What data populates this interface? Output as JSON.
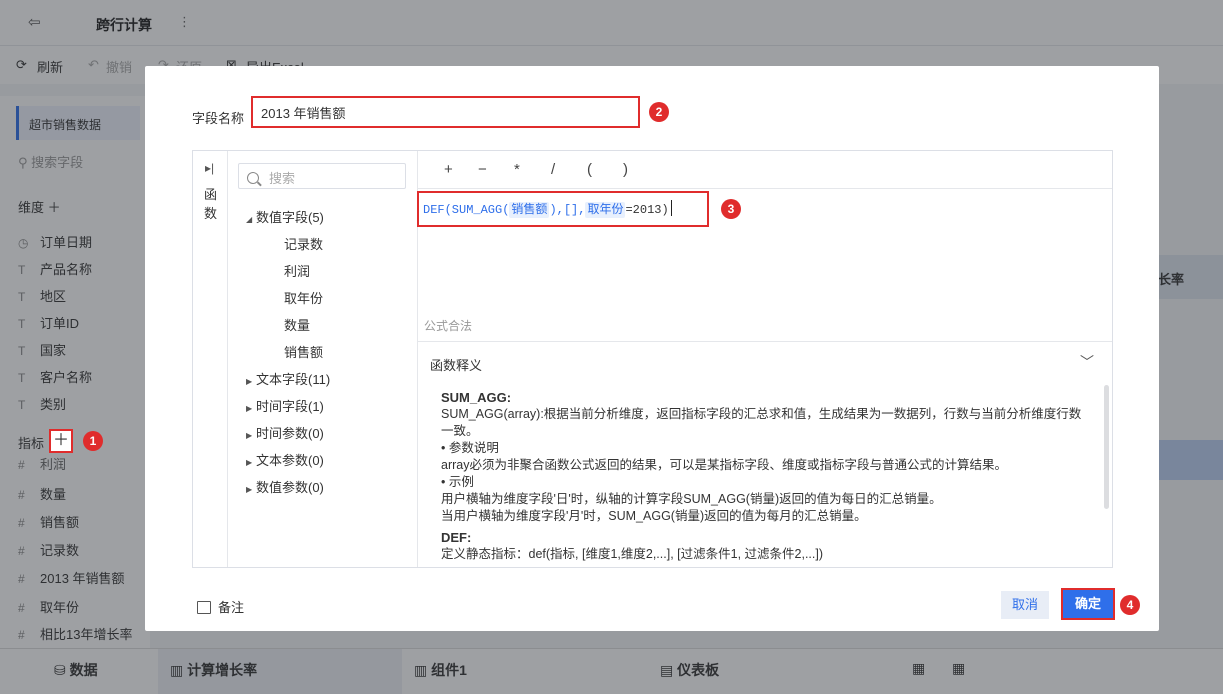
{
  "app": {
    "title": "跨行计算",
    "toolbar": {
      "refresh": "刷新",
      "undo": "撤销",
      "redo": "还原",
      "export": "导出Excel"
    },
    "sidebar": {
      "dataset": "超市销售数据",
      "search_placeholder": "搜索字段",
      "dimensions_label": "维度",
      "dimensions": [
        "订单日期",
        "产品名称",
        "地区",
        "订单ID",
        "国家",
        "客户名称",
        "类别"
      ],
      "measures_label": "指标",
      "measures": [
        "利润",
        "数量",
        "销售额",
        "记录数",
        "2013 年销售额",
        "取年份",
        "相比13年增长率"
      ]
    },
    "bottom_tabs": [
      "数据",
      "计算增长率",
      "组件1",
      "仪表板"
    ],
    "right_header": "长率"
  },
  "modal": {
    "field_name_label": "字段名称",
    "field_name_value": "2013 年销售额",
    "functions_toggle": "函数",
    "search_placeholder": "搜索",
    "tree": {
      "numeric": "数值字段(5)",
      "numeric_items": [
        "记录数",
        "利润",
        "取年份",
        "数量",
        "销售额"
      ],
      "text": "文本字段(11)",
      "time": "时间字段(1)",
      "time_param": "时间参数(0)",
      "text_param": "文本参数(0)",
      "num_param": "数值参数(0)"
    },
    "operators": [
      "+",
      "−",
      "*",
      "/",
      "(",
      ")"
    ],
    "formula": {
      "p1": "DEF(SUM_AGG(",
      "field1": "销售额",
      "p2": "),[],",
      "field2": "取年份",
      "p3": "=2013)"
    },
    "formula_status": "公式合法",
    "explain_title": "函数释义",
    "explain": {
      "sum_agg_title": "SUM_AGG:",
      "sum_agg_desc": "SUM_AGG(array):根据当前分析维度，返回指标字段的汇总求和值，生成结果为一数据列，行数与当前分析维度行数一致。",
      "param_title": "• 参数说明",
      "param_desc": "array必须为非聚合函数公式返回的结果，可以是某指标字段、维度或指标字段与普通公式的计算结果。",
      "example_title": "• 示例",
      "example_1": "用户横轴为维度字段'日'时，纵轴的计算字段SUM_AGG(销量)返回的值为每日的汇总销量。",
      "example_2": "当用户横轴为维度字段'月'时，SUM_AGG(销量)返回的值为每月的汇总销量。",
      "def_title": "DEF:",
      "def_desc": "定义静态指标：def(指标, [维度1,维度2,...], [过滤条件1, 过滤条件2,...])"
    },
    "note": "备注",
    "cancel": "取消",
    "confirm": "确定"
  },
  "badges": [
    "1",
    "2",
    "3",
    "4"
  ],
  "colors": {
    "accent": "#2f6fea",
    "highlight": "#e02c2c"
  }
}
